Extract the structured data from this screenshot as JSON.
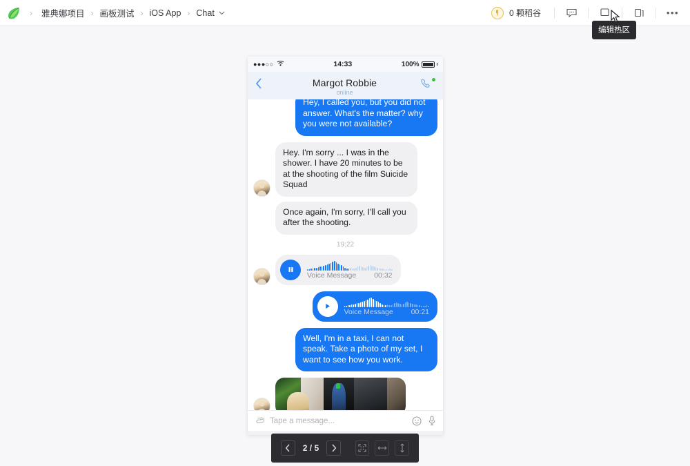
{
  "appbar": {
    "logo_icon": "leaf-logo",
    "breadcrumb": [
      {
        "label": "雅典娜项目"
      },
      {
        "label": "画板测试"
      },
      {
        "label": "iOS App"
      },
      {
        "label": "Chat"
      }
    ],
    "breadcrumb_separator": "›",
    "chat_dropdown_chevron": "⌄",
    "coin": {
      "icon": "rice-coin-icon",
      "glyph": "¥",
      "label": "0 颗稻谷"
    },
    "tools": [
      {
        "name": "comment-icon",
        "glyph": "▭"
      },
      {
        "name": "hotspot-icon",
        "glyph": "▭"
      },
      {
        "name": "copy-icon",
        "glyph": "⧉"
      },
      {
        "name": "more-icon",
        "glyph": "•••"
      }
    ],
    "tooltip": "编辑热区"
  },
  "phone": {
    "statusbar": {
      "signal_dots": "●●●○○",
      "wifi_icon": "wifi-icon",
      "time": "14:33",
      "battery_label": "100%"
    },
    "navbar": {
      "back_icon": "‹",
      "title": "Margot Robbie",
      "subtitle": "online",
      "call_icon": "phone-call-icon"
    },
    "messages": [
      {
        "id": "m1",
        "type": "text",
        "side": "out",
        "text": "Hey, I called you, but you did not answer. What's the matter? why you were not available?"
      },
      {
        "id": "m2",
        "type": "text",
        "side": "in",
        "avatar": true,
        "text": "Hey. I'm sorry ... I was in the shower. I have 20 minutes to be at the shooting of the film Suicide Squad"
      },
      {
        "id": "m3",
        "type": "text",
        "side": "in",
        "text": "Once again, I'm sorry, I'll call you after the shooting."
      },
      {
        "id": "m4",
        "type": "timestamp",
        "text": "19:22"
      },
      {
        "id": "m5",
        "type": "voice",
        "side": "in",
        "avatar": true,
        "button_icon": "pause-icon",
        "label": "Voice Message",
        "duration": "00:32"
      },
      {
        "id": "m6",
        "type": "voice",
        "side": "out",
        "button_icon": "play-icon",
        "label": "Voice Message",
        "duration": "00:21"
      },
      {
        "id": "m7",
        "type": "text",
        "side": "out",
        "text": "Well, I'm in a taxi, I can not speak. Take a photo of my set, I want to see how you work."
      },
      {
        "id": "m8",
        "type": "photo",
        "side": "in",
        "avatar": true,
        "alt": "photo-of-film-set"
      }
    ],
    "inputbar": {
      "attach_icon": "paperclip-icon",
      "placeholder": "Tape a message...",
      "value": "",
      "emoji_icon": "smiley-icon",
      "mic_icon": "microphone-icon"
    }
  },
  "toolbar": {
    "prev_icon": "‹",
    "next_icon": "›",
    "page_indicator": "2 / 5",
    "current_page": 2,
    "total_pages": 5,
    "fit_buttons": [
      {
        "name": "fit-screen-button",
        "glyph": "⛶"
      },
      {
        "name": "fit-width-button",
        "glyph": "↔"
      },
      {
        "name": "fit-height-button",
        "glyph": "↕"
      }
    ]
  },
  "colors": {
    "accent_blue": "#1877f2",
    "canvas_bg": "#f7f6f9",
    "bubble_in": "#f0f0f2",
    "toolbar_bg": "#2d2d31",
    "logo_green": "#4fc24f"
  }
}
